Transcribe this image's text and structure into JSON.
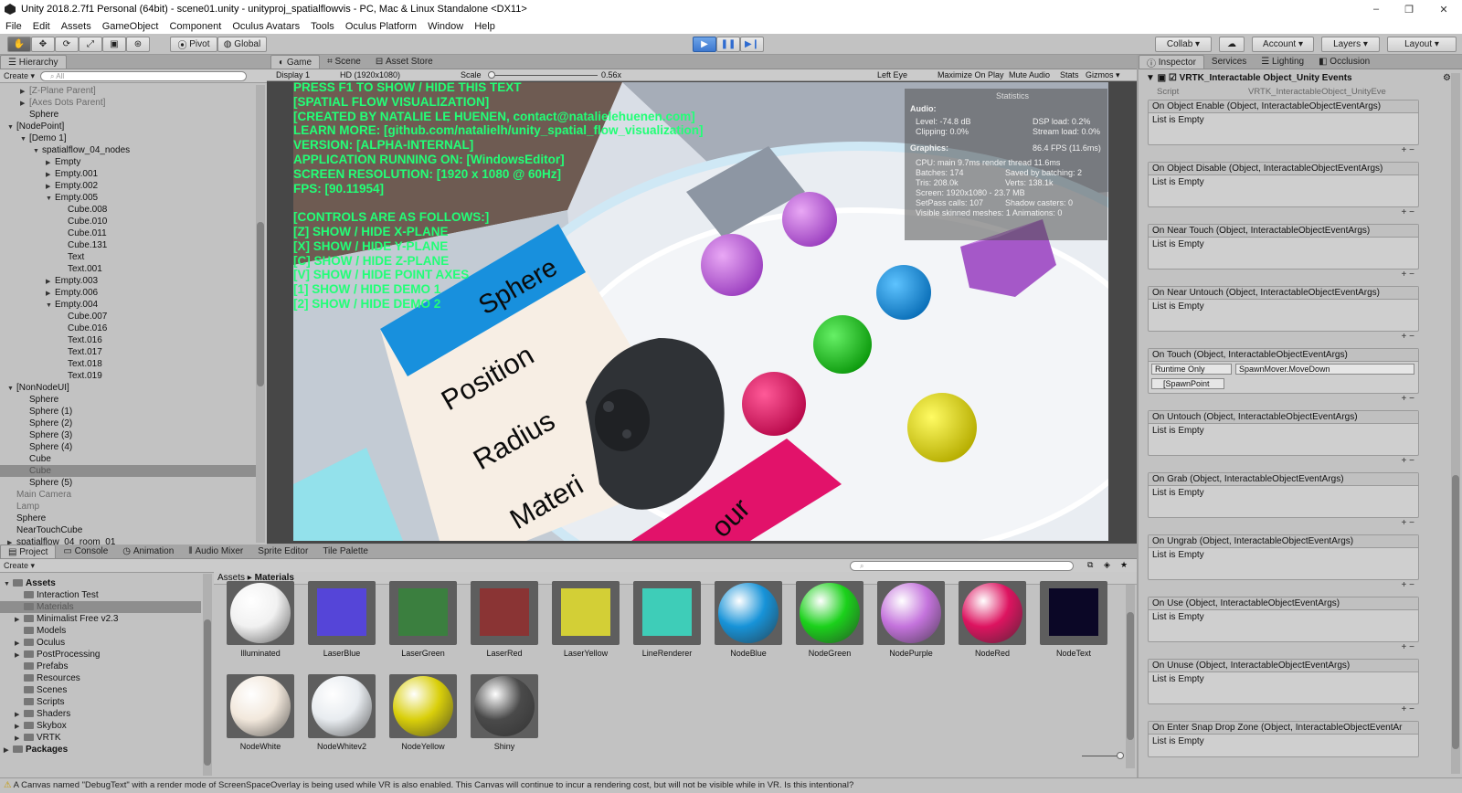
{
  "window": {
    "title": "Unity 2018.2.7f1 Personal (64bit) - scene01.unity - unityproj_spatialflowvis - PC, Mac & Linux Standalone <DX11>",
    "minimize": "–",
    "restore": "❐",
    "close": "✕"
  },
  "menu": [
    "File",
    "Edit",
    "Assets",
    "GameObject",
    "Component",
    "Oculus Avatars",
    "Tools",
    "Oculus Platform",
    "Window",
    "Help"
  ],
  "toolbar": {
    "pivot": "Pivot",
    "global": "Global",
    "collab": "Collab ▾",
    "account": "Account ▾",
    "layers": "Layers ▾",
    "layout": "Layout ▾"
  },
  "hierarchy": {
    "tab": "Hierarchy",
    "create": "Create ▾",
    "search_placeholder": "All",
    "rows": [
      {
        "label": "[Z-Plane Parent]",
        "indent": 1,
        "arrow": "▶",
        "cls": "gray"
      },
      {
        "label": "[Axes Dots Parent]",
        "indent": 1,
        "arrow": "▶",
        "cls": "gray"
      },
      {
        "label": "Sphere",
        "indent": 1,
        "arrow": "",
        "cls": ""
      },
      {
        "label": "[NodePoint]",
        "indent": 0,
        "arrow": "▼",
        "cls": ""
      },
      {
        "label": "[Demo 1]",
        "indent": 1,
        "arrow": "▼",
        "cls": ""
      },
      {
        "label": "spatialflow_04_nodes",
        "indent": 2,
        "arrow": "▼",
        "cls": ""
      },
      {
        "label": "Empty",
        "indent": 3,
        "arrow": "▶",
        "cls": ""
      },
      {
        "label": "Empty.001",
        "indent": 3,
        "arrow": "▶",
        "cls": ""
      },
      {
        "label": "Empty.002",
        "indent": 3,
        "arrow": "▶",
        "cls": ""
      },
      {
        "label": "Empty.005",
        "indent": 3,
        "arrow": "▼",
        "cls": ""
      },
      {
        "label": "Cube.008",
        "indent": 4,
        "arrow": "",
        "cls": ""
      },
      {
        "label": "Cube.010",
        "indent": 4,
        "arrow": "",
        "cls": ""
      },
      {
        "label": "Cube.011",
        "indent": 4,
        "arrow": "",
        "cls": ""
      },
      {
        "label": "Cube.131",
        "indent": 4,
        "arrow": "",
        "cls": ""
      },
      {
        "label": "Text",
        "indent": 4,
        "arrow": "",
        "cls": ""
      },
      {
        "label": "Text.001",
        "indent": 4,
        "arrow": "",
        "cls": ""
      },
      {
        "label": "Empty.003",
        "indent": 3,
        "arrow": "▶",
        "cls": ""
      },
      {
        "label": "Empty.006",
        "indent": 3,
        "arrow": "▶",
        "cls": ""
      },
      {
        "label": "Empty.004",
        "indent": 3,
        "arrow": "▼",
        "cls": ""
      },
      {
        "label": "Cube.007",
        "indent": 4,
        "arrow": "",
        "cls": ""
      },
      {
        "label": "Cube.016",
        "indent": 4,
        "arrow": "",
        "cls": ""
      },
      {
        "label": "Text.016",
        "indent": 4,
        "arrow": "",
        "cls": ""
      },
      {
        "label": "Text.017",
        "indent": 4,
        "arrow": "",
        "cls": ""
      },
      {
        "label": "Text.018",
        "indent": 4,
        "arrow": "",
        "cls": ""
      },
      {
        "label": "Text.019",
        "indent": 4,
        "arrow": "",
        "cls": ""
      },
      {
        "label": "[NonNodeUI]",
        "indent": 0,
        "arrow": "▼",
        "cls": ""
      },
      {
        "label": "Sphere",
        "indent": 1,
        "arrow": "",
        "cls": ""
      },
      {
        "label": "Sphere (1)",
        "indent": 1,
        "arrow": "",
        "cls": ""
      },
      {
        "label": "Sphere (2)",
        "indent": 1,
        "arrow": "",
        "cls": ""
      },
      {
        "label": "Sphere (3)",
        "indent": 1,
        "arrow": "",
        "cls": ""
      },
      {
        "label": "Sphere (4)",
        "indent": 1,
        "arrow": "",
        "cls": ""
      },
      {
        "label": "Cube",
        "indent": 1,
        "arrow": "",
        "cls": ""
      },
      {
        "label": "Cube",
        "indent": 1,
        "arrow": "",
        "cls": "sel"
      },
      {
        "label": "Sphere (5)",
        "indent": 1,
        "arrow": "",
        "cls": ""
      },
      {
        "label": "Main Camera",
        "indent": 0,
        "arrow": "",
        "cls": "gray"
      },
      {
        "label": "Lamp",
        "indent": 0,
        "arrow": "",
        "cls": "gray"
      },
      {
        "label": "Sphere",
        "indent": 0,
        "arrow": "",
        "cls": ""
      },
      {
        "label": "NearTouchCube",
        "indent": 0,
        "arrow": "",
        "cls": ""
      },
      {
        "label": "spatialflow_04_room_01",
        "indent": 0,
        "arrow": "▶",
        "cls": ""
      }
    ]
  },
  "scene_tabs": {
    "game": "Game",
    "scene": "Scene",
    "asset_store": "Asset Store"
  },
  "game_bar": {
    "display": "Display 1",
    "resolution": "HD (1920x1080)",
    "scale_label": "Scale",
    "scale_value": "0.56x",
    "left_eye": "Left Eye",
    "maximize": "Maximize On Play",
    "mute": "Mute Audio",
    "stats": "Stats",
    "gizmos": "Gizmos ▾"
  },
  "overlay_lines": [
    "PRESS F1 TO SHOW / HIDE THIS TEXT",
    "[SPATIAL FLOW VISUALIZATION]",
    "[CREATED BY NATALIE LE HUENEN, contact@natalielehuenen.com]",
    "LEARN MORE: [github.com/natalielh/unity_spatial_flow_visualization]",
    "VERSION: [ALPHA-INTERNAL]",
    "APPLICATION RUNNING ON: [WindowsEditor]",
    "SCREEN RESOLUTION: [1920 x 1080 @ 60Hz]",
    "FPS: [90.11954]",
    "",
    "[CONTROLS ARE AS FOLLOWS:]",
    "[Z] SHOW / HIDE X-PLANE",
    "[X] SHOW / HIDE Y-PLANE",
    "[C] SHOW / HIDE Z-PLANE",
    "[V] SHOW / HIDE POINT AXES",
    "[1] SHOW / HIDE DEMO 1",
    "[2] SHOW / HIDE DEMO 2"
  ],
  "stats": {
    "title": "Statistics",
    "audio_label": "Audio:",
    "level": "Level: -74.8 dB",
    "dsp": "DSP load: 0.2%",
    "clipping": "Clipping: 0.0%",
    "stream": "Stream load: 0.0%",
    "graphics_label": "Graphics:",
    "fps": "86.4 FPS (11.6ms)",
    "cpu": "CPU: main 9.7ms  render thread 11.6ms",
    "batches": "Batches: 174",
    "saved": "Saved by batching: 2",
    "tris": "Tris: 208.0k",
    "verts": "Verts: 138.1k",
    "screen": "Screen: 1920x1080 - 23.7 MB",
    "setpass": "SetPass calls: 107",
    "shadow": "Shadow casters: 0",
    "skinned": "Visible skinned meshes: 1  Animations: 0"
  },
  "scene_text": {
    "sphere": "Sphere",
    "position": "Position",
    "radius": "Radius",
    "material": "Materi",
    "colour": "our"
  },
  "inspector": {
    "tabs": [
      "Inspector",
      "Services",
      "Lighting",
      "Occlusion"
    ],
    "component": "VRTK_Interactable Object_Unity Events",
    "script_label": "Script",
    "script_value": "VRTK_InteractableObject_UnityEve",
    "empty": "List is Empty",
    "runtime": "Runtime Only",
    "method": "SpawnMover.MoveDown",
    "object": "[SpawnPoint",
    "events": [
      "On Object Enable (Object, InteractableObjectEventArgs)",
      "On Object Disable (Object, InteractableObjectEventArgs)",
      "On Near Touch (Object, InteractableObjectEventArgs)",
      "On Near Untouch (Object, InteractableObjectEventArgs)",
      "On Touch (Object, InteractableObjectEventArgs)",
      "On Untouch (Object, InteractableObjectEventArgs)",
      "On Grab (Object, InteractableObjectEventArgs)",
      "On Ungrab (Object, InteractableObjectEventArgs)",
      "On Use (Object, InteractableObjectEventArgs)",
      "On Unuse (Object, InteractableObjectEventArgs)",
      "On Enter Snap Drop Zone (Object, InteractableObjectEventAr"
    ]
  },
  "project": {
    "tabs": [
      "Project",
      "Console",
      "Animation",
      "Audio Mixer",
      "Sprite Editor",
      "Tile Palette"
    ],
    "create": "Create ▾",
    "breadcrumb_root": "Assets",
    "breadcrumb_sep": "▸",
    "breadcrumb_current": "Materials",
    "tree": [
      {
        "label": "Assets",
        "indent": 0,
        "arrow": "▼",
        "bold": true
      },
      {
        "label": "Interaction Test",
        "indent": 1,
        "arrow": "",
        "bold": false
      },
      {
        "label": "Materials",
        "indent": 1,
        "arrow": "",
        "bold": false,
        "sel": true
      },
      {
        "label": "Minimalist Free v2.3",
        "indent": 1,
        "arrow": "▶",
        "bold": false
      },
      {
        "label": "Models",
        "indent": 1,
        "arrow": "",
        "bold": false
      },
      {
        "label": "Oculus",
        "indent": 1,
        "arrow": "▶",
        "bold": false
      },
      {
        "label": "PostProcessing",
        "indent": 1,
        "arrow": "▶",
        "bold": false
      },
      {
        "label": "Prefabs",
        "indent": 1,
        "arrow": "",
        "bold": false
      },
      {
        "label": "Resources",
        "indent": 1,
        "arrow": "",
        "bold": false
      },
      {
        "label": "Scenes",
        "indent": 1,
        "arrow": "",
        "bold": false
      },
      {
        "label": "Scripts",
        "indent": 1,
        "arrow": "",
        "bold": false
      },
      {
        "label": "Shaders",
        "indent": 1,
        "arrow": "▶",
        "bold": false
      },
      {
        "label": "Skybox",
        "indent": 1,
        "arrow": "▶",
        "bold": false
      },
      {
        "label": "VRTK",
        "indent": 1,
        "arrow": "▶",
        "bold": false
      },
      {
        "label": "Packages",
        "indent": 0,
        "arrow": "▶",
        "bold": true
      }
    ],
    "assets": [
      {
        "name": "Illuminated",
        "kind": "sphere",
        "color": "#f1f1f1"
      },
      {
        "name": "LaserBlue",
        "kind": "flat",
        "color": "#5545d8"
      },
      {
        "name": "LaserGreen",
        "kind": "flat",
        "color": "#3b7f3f"
      },
      {
        "name": "LaserRed",
        "kind": "flat",
        "color": "#8a3434"
      },
      {
        "name": "LaserYellow",
        "kind": "flat",
        "color": "#d3cf36"
      },
      {
        "name": "LineRenderer",
        "kind": "flat",
        "color": "#3ecdb8"
      },
      {
        "name": "NodeBlue",
        "kind": "sphere",
        "color": "#1793d8"
      },
      {
        "name": "NodeGreen",
        "kind": "sphere",
        "color": "#1bd11b"
      },
      {
        "name": "NodePurple",
        "kind": "sphere",
        "color": "#c473dc"
      },
      {
        "name": "NodeRed",
        "kind": "sphere",
        "color": "#dd1460"
      },
      {
        "name": "NodeText",
        "kind": "flat",
        "color": "#0b0726"
      },
      {
        "name": "NodeWhite",
        "kind": "sphere",
        "color": "#f2e8dc"
      },
      {
        "name": "NodeWhitev2",
        "kind": "sphere",
        "color": "#e8ecf0"
      },
      {
        "name": "NodeYellow",
        "kind": "sphere",
        "color": "#d9cf0a"
      },
      {
        "name": "Shiny",
        "kind": "sphere",
        "color": "#4a4a4a"
      }
    ]
  },
  "status": "A Canvas named \"DebugText\" with a render mode of ScreenSpaceOverlay is being used while VR is also enabled. This Canvas will continue to incur a rendering cost, but will not be visible while in VR. Is this intentional?"
}
